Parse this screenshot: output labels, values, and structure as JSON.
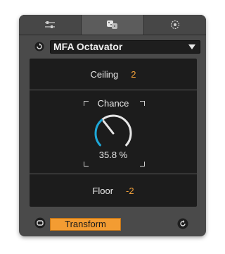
{
  "tabs": [
    {
      "icon": "sliders-icon",
      "active": false
    },
    {
      "icon": "dice-icon",
      "active": true
    },
    {
      "icon": "target-icon",
      "active": false
    }
  ],
  "header": {
    "reset_icon": "reset-icon",
    "preset_name": "MFA Octavator",
    "dropdown_icon": "triangle-down-icon"
  },
  "params": {
    "ceiling": {
      "label": "Ceiling",
      "value": "2"
    },
    "chance": {
      "label": "Chance",
      "value_text": "35.8 %",
      "value": 35.8
    },
    "floor": {
      "label": "Floor",
      "value": "-2"
    }
  },
  "footer": {
    "loop_icon": "loop-icon",
    "transform_label": "Transform",
    "refresh_icon": "refresh-icon"
  },
  "colors": {
    "accent": "#f4a23a",
    "knob_arc": "#1ea8d8",
    "button": "#f39c32"
  }
}
